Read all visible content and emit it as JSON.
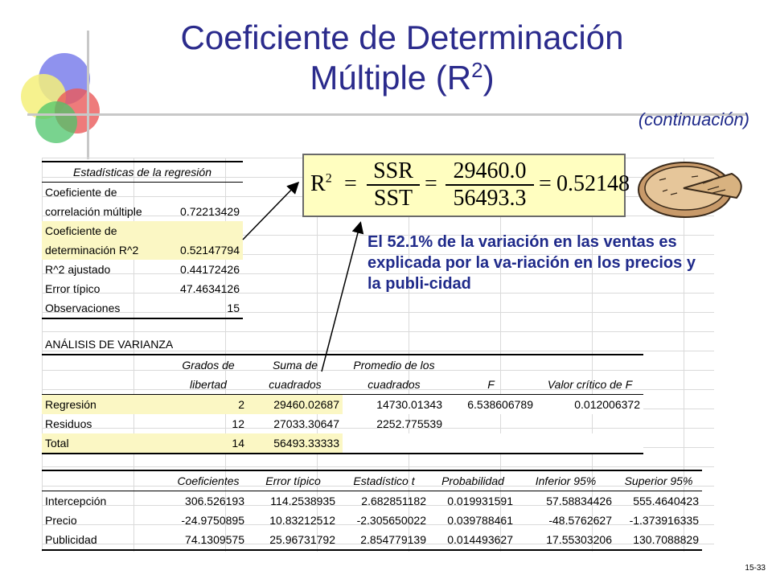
{
  "title": {
    "line1": "Coeficiente de Determinación",
    "line2_prefix": "Múltiple (R",
    "line2_sup": "2",
    "line2_suffix": ")",
    "subtitle": "(continuación)"
  },
  "regression_stats": {
    "header": "Estadísticas de la regresión",
    "rows": [
      {
        "label1": "Coeficiente de",
        "label2": "correlación múltiple",
        "value": "0.72213429"
      },
      {
        "label1": "Coeficiente de",
        "label2": "determinación R^2",
        "value": "0.52147794"
      },
      {
        "label": "R^2  ajustado",
        "value": "0.44172426"
      },
      {
        "label": "Error típico",
        "value": "47.4634126"
      },
      {
        "label": "Observaciones",
        "value": "15"
      }
    ]
  },
  "anova": {
    "title": "ANÁLISIS DE VARIANZA",
    "headers": [
      {
        "l1": "Grados de",
        "l2": "libertad"
      },
      {
        "l1": "Suma de",
        "l2": "cuadrados"
      },
      {
        "l1": "Promedio de los",
        "l2": "cuadrados"
      },
      {
        "l1": "",
        "l2": "F"
      },
      {
        "l1": "",
        "l2": "Valor crítico de F"
      }
    ],
    "rows": [
      {
        "label": "Regresión",
        "df": "2",
        "ss": "29460.02687",
        "ms": "14730.01343",
        "f": "6.538606789",
        "sig": "0.012006372"
      },
      {
        "label": "Residuos",
        "df": "12",
        "ss": "27033.30647",
        "ms": "2252.775539",
        "f": "",
        "sig": ""
      },
      {
        "label": "Total",
        "df": "14",
        "ss": "56493.33333",
        "ms": "",
        "f": "",
        "sig": ""
      }
    ]
  },
  "coefficients": {
    "headers": [
      "Coeficientes",
      "Error típico",
      "Estadístico t",
      "Probabilidad",
      "Inferior 95%",
      "Superior 95%"
    ],
    "rows": [
      {
        "label": "Intercepción",
        "vals": [
          "306.526193",
          "114.2538935",
          "2.682851182",
          "0.019931591",
          "57.58834426",
          "555.4640423"
        ]
      },
      {
        "label": "Precio",
        "vals": [
          "-24.9750895",
          "10.83212512",
          "-2.305650022",
          "0.039788461",
          "-48.5762627",
          "-1.373916335"
        ]
      },
      {
        "label": "Publicidad",
        "vals": [
          "74.1309575",
          "25.96731792",
          "2.854779139",
          "0.014493627",
          "17.55303206",
          "130.7088829"
        ]
      }
    ]
  },
  "formula": {
    "lhs": "R",
    "lhs_sup": "2",
    "eq": "=",
    "n1": "SSR",
    "d1": "SST",
    "n2": "29460.0",
    "d2": "56493.3",
    "result": "0.52148"
  },
  "explanation": "El 52.1% de la variación en las ventas es explicada por la va-riación en los precios y la publi-cidad",
  "page_number": "15-33",
  "colors": {
    "title": "#2b2b8c",
    "highlight": "#fbf7c4",
    "formula_bg": "#fffec0",
    "text_blue": "#1f2a8a"
  },
  "icons": [
    "logo-circles-icon",
    "pie-icon"
  ]
}
